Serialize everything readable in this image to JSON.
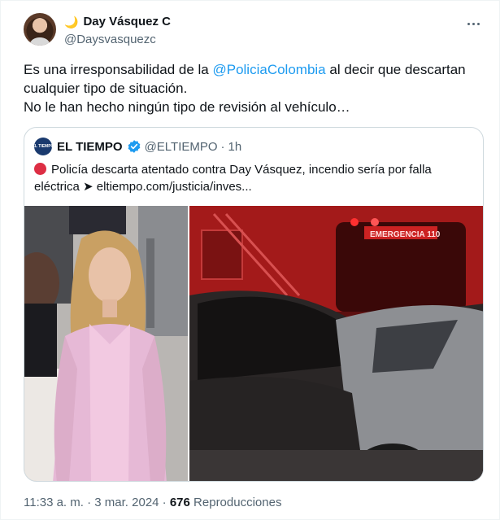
{
  "author": {
    "display_name": "Day Vásquez C",
    "emoji": "🌙",
    "handle": "@Daysvasquezc"
  },
  "tweet": {
    "text_part1": "Es una irresponsabilidad de la ",
    "mention": "@PoliciaColombia",
    "text_part2": " al decir que descartan cualquier tipo de situación.",
    "line2": "No le han hecho ningún tipo de revisión al vehículo…"
  },
  "quote": {
    "avatar_text": "EL TIEMPO",
    "name": "EL TIEMPO",
    "handle": "@ELTIEMPO",
    "separator": "·",
    "time": "1h",
    "text": "Policía descarta atentado contra Day Vásquez, incendio sería por falla eléctrica ➤ eltiempo.com/justicia/inves...",
    "truck_label": "EMERGENCIA 110"
  },
  "meta": {
    "time": "11:33 a. m.",
    "separator1": "·",
    "date": "3 mar. 2024",
    "separator2": "·",
    "views_count": "676",
    "views_label": "Reproducciones"
  },
  "colors": {
    "accent": "#1d9bf0",
    "secondary_text": "#536471",
    "border": "#cfd9de",
    "alert_red": "#dd2e44"
  }
}
